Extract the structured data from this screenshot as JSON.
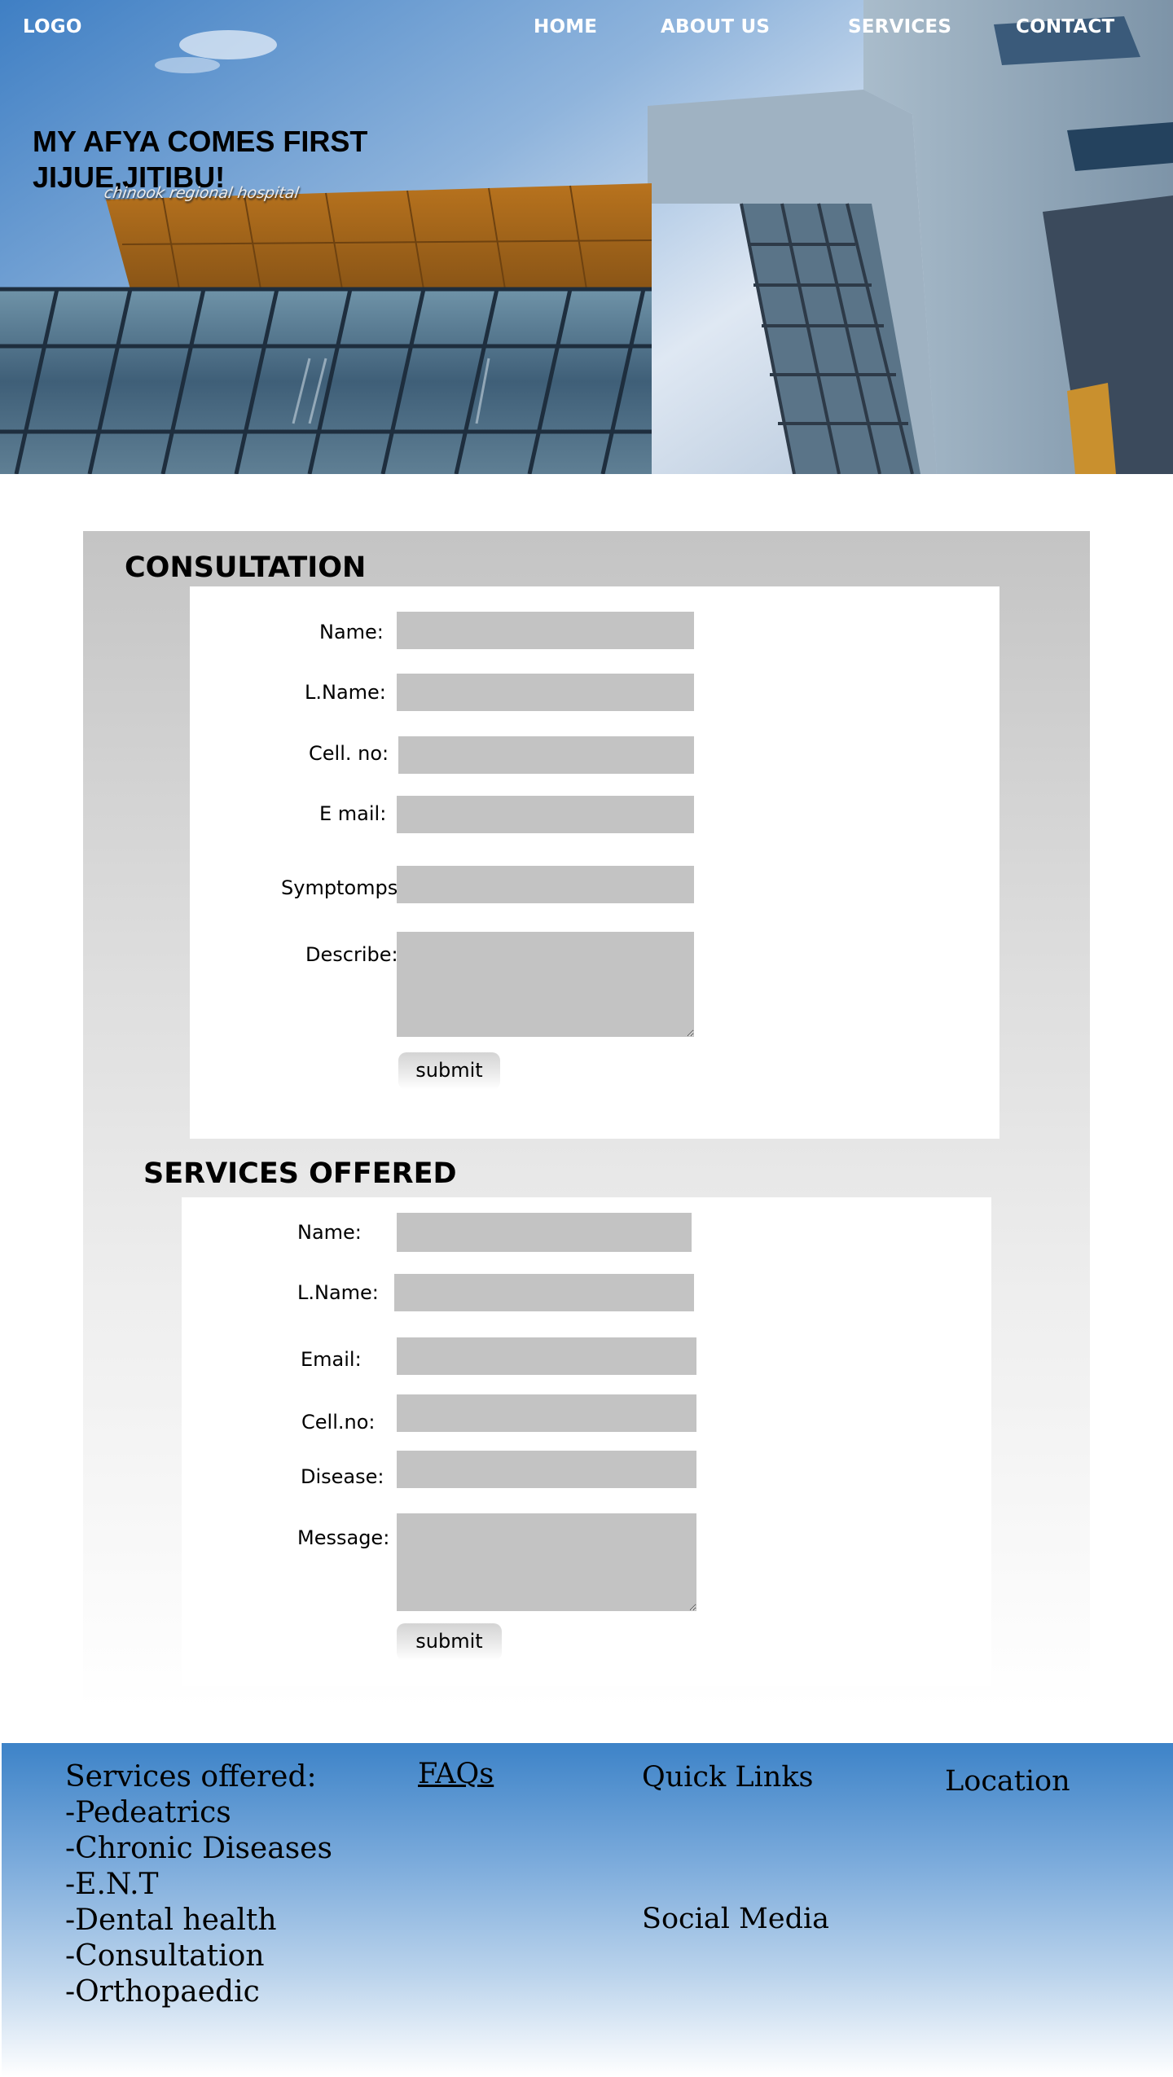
{
  "nav": {
    "logo": "LOGO",
    "items": [
      {
        "label": "HOME"
      },
      {
        "label": "ABOUT US"
      },
      {
        "label": "SERVICES"
      },
      {
        "label": "CONTACT"
      }
    ]
  },
  "hero": {
    "heading_line1": "MY AFYA COMES FIRST",
    "heading_line2": "JIJUE,JITIBU!",
    "building_sign": "chinook regional hospital"
  },
  "consultation": {
    "title": "CONSULTATION",
    "fields": [
      {
        "label": "Name:",
        "value": ""
      },
      {
        "label": "L.Name:",
        "value": ""
      },
      {
        "label": "Cell. no:",
        "value": ""
      },
      {
        "label": "E mail:",
        "value": ""
      },
      {
        "label": "Symptomps:",
        "value": ""
      },
      {
        "label": "Describe:",
        "value": ""
      }
    ],
    "submit_label": "submit"
  },
  "services_offered": {
    "title": "SERVICES OFFERED",
    "fields": [
      {
        "label": "Name:",
        "value": ""
      },
      {
        "label": "L.Name:",
        "value": ""
      },
      {
        "label": "Email:",
        "value": ""
      },
      {
        "label": "Cell.no:",
        "value": ""
      },
      {
        "label": "Disease:",
        "value": ""
      },
      {
        "label": "Message:",
        "value": ""
      }
    ],
    "submit_label": "submit"
  },
  "footer": {
    "services_heading": "Services offered:",
    "services": [
      "-Pedeatrics",
      "-Chronic Diseases",
      "-E.N.T",
      "-Dental health",
      "-Consultation",
      "-Orthopaedic"
    ],
    "faqs": "FAQs",
    "quick_links": "Quick Links",
    "location": "Location",
    "social_media": "Social Media"
  },
  "colors": {
    "form_field": "#c3c3c3",
    "panel_gray": "#c4c4c4",
    "footer_blue": "#3d83c8",
    "nav_text": "#ffffff"
  }
}
